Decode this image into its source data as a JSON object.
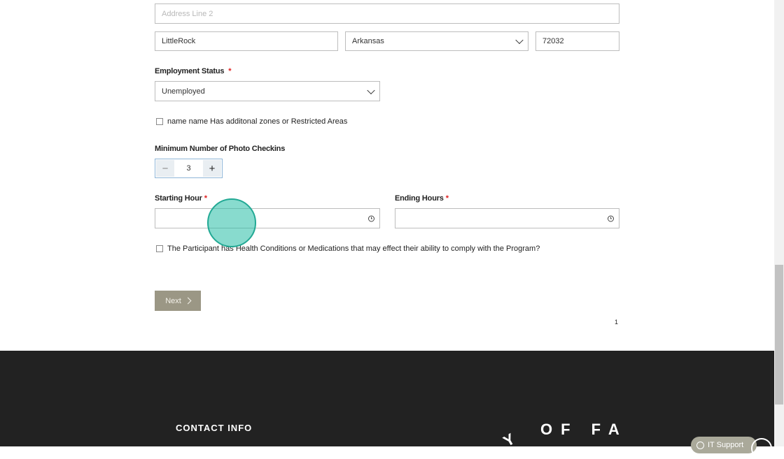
{
  "address": {
    "line2_placeholder": "Address Line 2",
    "city": "LittleRock",
    "state": "Arkansas",
    "zip": "72032"
  },
  "employment": {
    "label": "Employment Status",
    "required_mark": "*",
    "value": "Unemployed"
  },
  "zones_checkbox": {
    "label": "name name Has additonal zones or Restricted Areas",
    "checked": false
  },
  "photo_checkins": {
    "label": "Minimum Number of Photo Checkins",
    "value": "3",
    "minus": "−",
    "plus": "+"
  },
  "starting_hour": {
    "label": "Starting Hour",
    "required_mark": "*",
    "value": ""
  },
  "ending_hours": {
    "label": "Ending Hours",
    "required_mark": "*",
    "value": ""
  },
  "health_checkbox": {
    "label": "The Participant has Health Conditions or Medications that may effect their ability to comply with the Program?",
    "checked": false
  },
  "next_button": {
    "label": "Next"
  },
  "pager": {
    "page": "1"
  },
  "footer": {
    "contact_heading": "CONTACT INFO",
    "logo_text": "OF FA",
    "logo_partial_left": "Y"
  },
  "support_widget": {
    "label": "IT Support"
  },
  "colors": {
    "next_button_bg": "#9b9785",
    "footer_bg": "#222222",
    "required": "#e02020",
    "cursor": "#22a994"
  }
}
